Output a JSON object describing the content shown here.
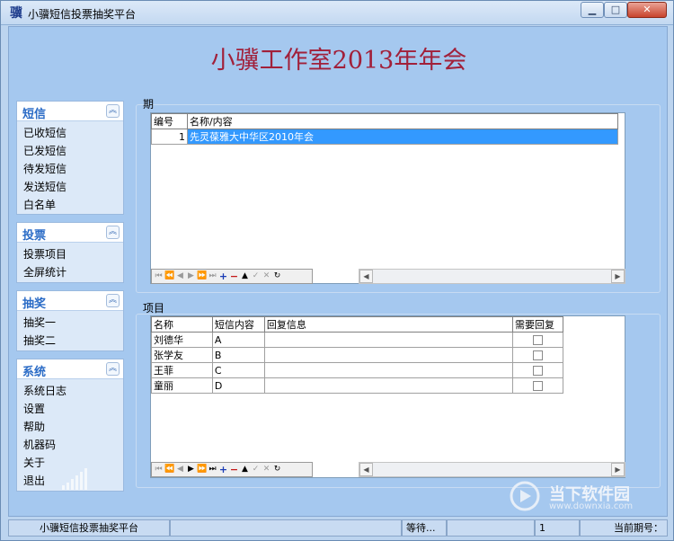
{
  "window": {
    "title": "小骥短信投票抽奖平台",
    "app_icon_char": "骥"
  },
  "banner": "小骥工作室2013年年会",
  "sidebar": [
    {
      "title": "短信",
      "items": [
        "已收短信",
        "已发短信",
        "待发短信",
        "发送短信",
        "白名单"
      ]
    },
    {
      "title": "投票",
      "items": [
        "投票项目",
        "全屏统计"
      ]
    },
    {
      "title": "抽奖",
      "items": [
        "抽奖一",
        "抽奖二"
      ]
    },
    {
      "title": "系统",
      "items": [
        "系统日志",
        "设置",
        "帮助",
        "机器码",
        "关于",
        "退出"
      ]
    }
  ],
  "period": {
    "legend": "期",
    "columns": [
      "编号",
      "名称/内容"
    ],
    "rows": [
      {
        "no": "1",
        "name": "先灵葆雅大中华区2010年会"
      }
    ]
  },
  "items": {
    "legend": "项目",
    "columns": [
      "名称",
      "短信内容",
      "回复信息",
      "需要回复"
    ],
    "rows": [
      {
        "name": "刘德华",
        "sms": "A",
        "reply": "",
        "need_reply": false
      },
      {
        "name": "张学友",
        "sms": "B",
        "reply": "",
        "need_reply": false
      },
      {
        "name": "王菲",
        "sms": "C",
        "reply": "",
        "need_reply": false
      },
      {
        "name": "童丽",
        "sms": "D",
        "reply": "",
        "need_reply": false
      }
    ]
  },
  "statusbar": {
    "app": "小骥短信投票抽奖平台",
    "state": "等待...",
    "count": "1",
    "current_period_label": "当前期号："
  },
  "watermark": {
    "text": "当下软件园",
    "url": "www.downxia.com"
  },
  "colors": {
    "banner": "#a1203a",
    "accent": "#2a6bc6",
    "selection": "#3399ff"
  }
}
